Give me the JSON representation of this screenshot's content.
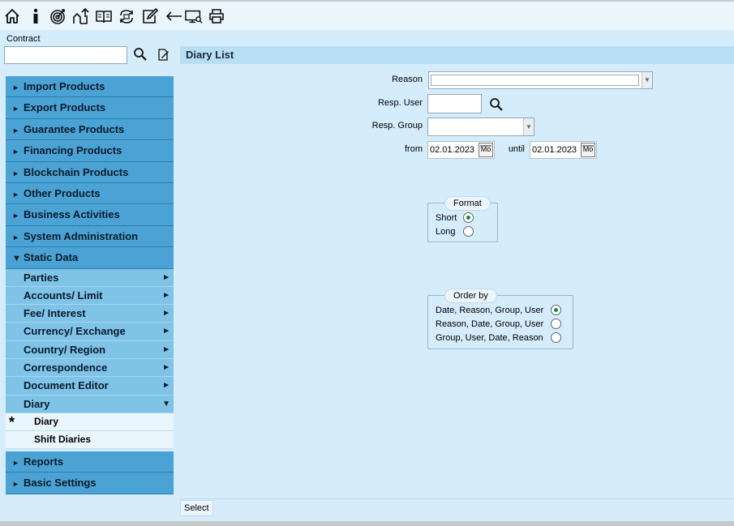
{
  "toolbar": {
    "icons": [
      "home-icon",
      "info-icon",
      "target-icon",
      "sign-out-icon",
      "book-icon",
      "refresh-cycle-icon",
      "edit-icon",
      "back-arrow-icon",
      "screen-search-icon",
      "print-icon"
    ]
  },
  "contract": {
    "label": "Contract",
    "value": ""
  },
  "nav": {
    "import_products": "Import Products",
    "export_products": "Export Products",
    "guarantee_products": "Guarantee Products",
    "financing_products": "Financing Products",
    "blockchain_products": "Blockchain Products",
    "other_products": "Other Products",
    "business_activities": "Business Activities",
    "system_administration": "System Administration",
    "static_data": "Static Data",
    "static_data_items": {
      "parties": "Parties",
      "accounts_limit": "Accounts/ Limit",
      "fee_interest": "Fee/ Interest",
      "currency_exchange": "Currency/ Exchange",
      "country_region": "Country/ Region",
      "correspondence": "Correspondence",
      "document_editor": "Document Editor",
      "diary": "Diary"
    },
    "diary_items": {
      "diary": "Diary",
      "shift_diaries": "Shift Diaries"
    },
    "active_marker": "*",
    "reports": "Reports",
    "basic_settings": "Basic Settings"
  },
  "main": {
    "title": "Diary List",
    "reason_label": "Reason",
    "reason_value": "",
    "resp_user_label": "Resp. User",
    "resp_user_value": "",
    "resp_group_label": "Resp. Group",
    "resp_group_value": "",
    "from_label": "from",
    "from_value": "02.01.2023",
    "until_label": "until",
    "until_value": "02.01.2023",
    "calendar_icon_text": "Mo",
    "format": {
      "legend": "Format",
      "options": [
        "Short",
        "Long"
      ],
      "selected": "Short"
    },
    "order_by": {
      "legend": "Order by",
      "options": [
        "Date, Reason, Group, User",
        "Reason, Date, Group, User",
        "Group, User, Date, Reason"
      ],
      "selected": "Date, Reason, Group, User"
    },
    "select_button": "Select"
  },
  "colors": {
    "nav_main": "#4aa3d4",
    "nav_sub": "#7fc3e7",
    "nav_leaf": "#eaf6fd",
    "background": "#d5ecfb",
    "title_bar": "#b9dff5",
    "radio_selected": "#0a8f3a"
  }
}
